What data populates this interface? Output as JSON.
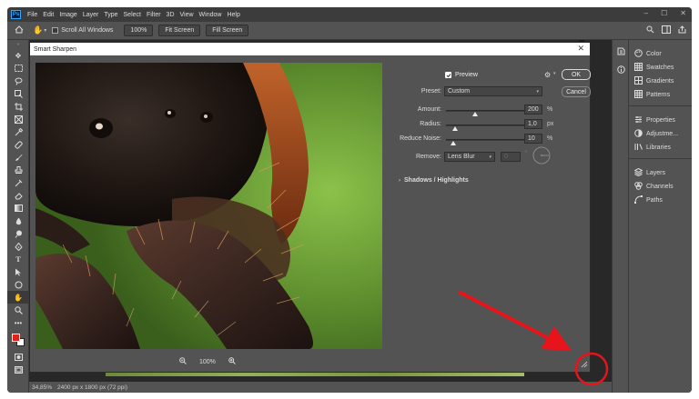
{
  "app": {
    "logo": "Ps"
  },
  "menu": [
    "File",
    "Edit",
    "Image",
    "Layer",
    "Type",
    "Select",
    "Filter",
    "3D",
    "View",
    "Window",
    "Help"
  ],
  "window_controls": {
    "minimize": "–",
    "restore": "☐",
    "close": "✕"
  },
  "options_bar": {
    "scroll_all_label": "Scroll All Windows",
    "zoom_value": "100%",
    "fit_screen": "Fit Screen",
    "fill_screen": "Fill Screen"
  },
  "dialog": {
    "title": "Smart Sharpen",
    "close": "✕",
    "preview_label": "Preview",
    "ok": "OK",
    "cancel": "Cancel",
    "preset_label": "Preset:",
    "preset_value": "Custom",
    "amount_label": "Amount:",
    "amount_value": "200",
    "amount_unit": "%",
    "radius_label": "Radius:",
    "radius_value": "1,0",
    "radius_unit": "px",
    "noise_label": "Reduce Noise:",
    "noise_value": "10",
    "noise_unit": "%",
    "remove_label": "Remove:",
    "remove_value": "Lens Blur",
    "angle_value": "0",
    "shadows_label": "Shadows / Highlights",
    "zoom_value": "100%",
    "sliders": {
      "amount": 0.5,
      "radius": 0.06,
      "noise": 0.1
    }
  },
  "status": {
    "zoom": "34,85%",
    "doc_info": "2400 px x 1800 px (72 ppi)"
  },
  "panels": {
    "group1": [
      "Color",
      "Swatches",
      "Gradients",
      "Patterns"
    ],
    "group2": [
      "Properties",
      "Adjustme...",
      "Libraries"
    ],
    "group3": [
      "Layers",
      "Channels",
      "Paths"
    ]
  },
  "colors": {
    "foreground": "#e0221d",
    "background": "#ffffff",
    "annotation": "#e8141b"
  }
}
